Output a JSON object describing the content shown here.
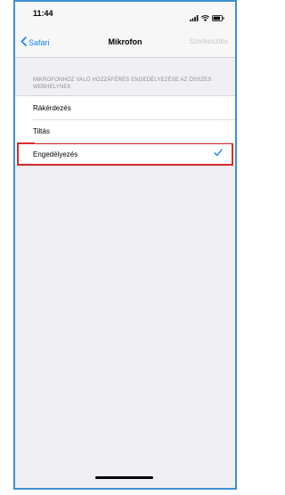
{
  "status_bar": {
    "time": "11:44",
    "icons": [
      "signal-icon",
      "wifi-icon",
      "battery-icon"
    ]
  },
  "nav": {
    "back_label": "Safari",
    "title": "Mikrofon",
    "edit_label": "Szerkesztés"
  },
  "section": {
    "header": "MIKROFONHOZ VALÓ HOZZÁFÉRÉS ENGEDÉLYEZÉSE AZ ÖSSZES WEBHELYNEK",
    "options": [
      {
        "label": "Rákérdezés",
        "selected": false
      },
      {
        "label": "Tiltás",
        "selected": false
      },
      {
        "label": "Engedélyezés",
        "selected": true
      }
    ]
  },
  "colors": {
    "accent": "#1a82fb",
    "highlight": "#d92b2b",
    "frame": "#3d8fd6"
  }
}
